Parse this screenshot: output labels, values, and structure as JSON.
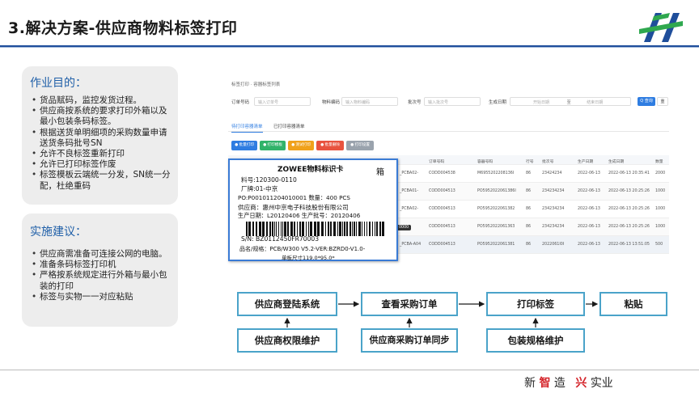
{
  "slide": {
    "title": "3.解决方案-供应商物料标签打印"
  },
  "objective_card": {
    "heading": "作业目的：",
    "items": [
      "货品赋码，监控发货过程。",
      "供应商按系统的要求打印外箱以及最小包装条码标签。",
      "根据送货单明细项的采购数量申请送货条码批号SN",
      "允许不良标签重新打印",
      "允许已打印标签作废",
      "标签模板云端统一分发，SN统一分配，杜绝重码"
    ]
  },
  "suggestion_card": {
    "heading": "实施建议：",
    "items": [
      "供应商需准备可连接公网的电脑。",
      "准备条码标签打印机",
      "严格按系统规定进行外箱与最小包装的打印",
      "标签与实物一一对应粘贴"
    ]
  },
  "screenshot": {
    "breadcrumb": "标签打印 ·  容器标签列表",
    "filters": {
      "order_label": "订单号码",
      "order_placeholder": "输入订单号",
      "material_label": "物料编码",
      "material_placeholder": "输入物料编码",
      "batch_label": "批次号",
      "batch_placeholder": "输入批次号",
      "date_label": "生成日期",
      "date_start_placeholder": "开始日期",
      "date_sep": "至",
      "date_end_placeholder": "结束日期",
      "query_button": "Q 查询",
      "reset_button": "重"
    },
    "tabs": [
      "待打印容器清单",
      "已打印容器清单"
    ],
    "actions": [
      {
        "label": "批量打印",
        "color": "#2f7de1"
      },
      {
        "label": "打印模板",
        "color": "#32b36a"
      },
      {
        "label": "测试打印",
        "color": "#f0a11b"
      },
      {
        "label": "批量删除",
        "color": "#e8533f"
      },
      {
        "label": "打印设置",
        "color": "#9aa3ad"
      }
    ],
    "columns": [
      "订单号码",
      "容器号码",
      "行号",
      "批次号",
      "生产日期",
      "生成日期",
      "数量"
    ],
    "rows": [
      {
        "mat": "_PCBA02-",
        "order": "CODD004538",
        "container": "M6955202208136I",
        "line": "86",
        "batch": "23424234",
        "pdate": "2022-06-13",
        "gdate": "2022-06-13 20:35:41",
        "qty": "2000"
      },
      {
        "mat": "_PCBA01-",
        "order": "CODD004513",
        "container": "PO5952022061386I",
        "line": "86",
        "batch": "234234234",
        "pdate": "2022-06-13",
        "gdate": "2022-06-13 20:25:26",
        "qty": "1000"
      },
      {
        "mat": "_PCBA02-",
        "order": "CODD004513",
        "container": "PO5952022061382",
        "line": "86",
        "batch": "234234234",
        "pdate": "2022-06-13",
        "gdate": "2022-06-13 20:25:26",
        "qty": "1000"
      },
      {
        "mat": "_PCBA01-",
        "order": "CODD004513",
        "container": "PO5952022061363",
        "line": "86",
        "batch": "234234234",
        "pdate": "2022-06-13",
        "gdate": "2022-06-13 20:25:26",
        "qty": "1000"
      },
      {
        "mat": "_PCBA-A04",
        "order": "CODD004513",
        "container": "PO5952022061381",
        "line": "86",
        "batch": "2022061I0I",
        "pdate": "2022-06-13",
        "gdate": "2022-06-13 13:51:05",
        "qty": "500"
      }
    ],
    "pager_badge": "0000"
  },
  "label_sample": {
    "title": "ZOWEE物料标识卡",
    "box": "箱",
    "part_no": "料号:120300-0110",
    "brand": "厂牌:01-中京",
    "po_qty": "PO:P001011204010001  数量：400 PCS",
    "supplier": "供应商：惠州中京电子科技股份有限公司",
    "dates": "生产日期：L20120406    生产批号：20120406",
    "sn": "S/N:            BZ0112450FR70003",
    "spec": "品名/规格：PCB/W300 V5.2-VER:BZRD0-V1.0-",
    "size": "单板尺寸119.0*95.0*"
  },
  "flow": {
    "top": [
      "供应商登陆系统",
      "查看采购订单",
      "打印标签",
      "粘贴"
    ],
    "bottom": [
      "供应商权限维护",
      "供应商采购订单同步",
      "包装规格维护"
    ],
    "border_color": "#4aa3c9"
  },
  "footer": {
    "slogan_a": "新",
    "slogan_b": "智",
    "slogan_c": "造",
    "slogan_d": "兴",
    "slogan_e": "实业"
  }
}
